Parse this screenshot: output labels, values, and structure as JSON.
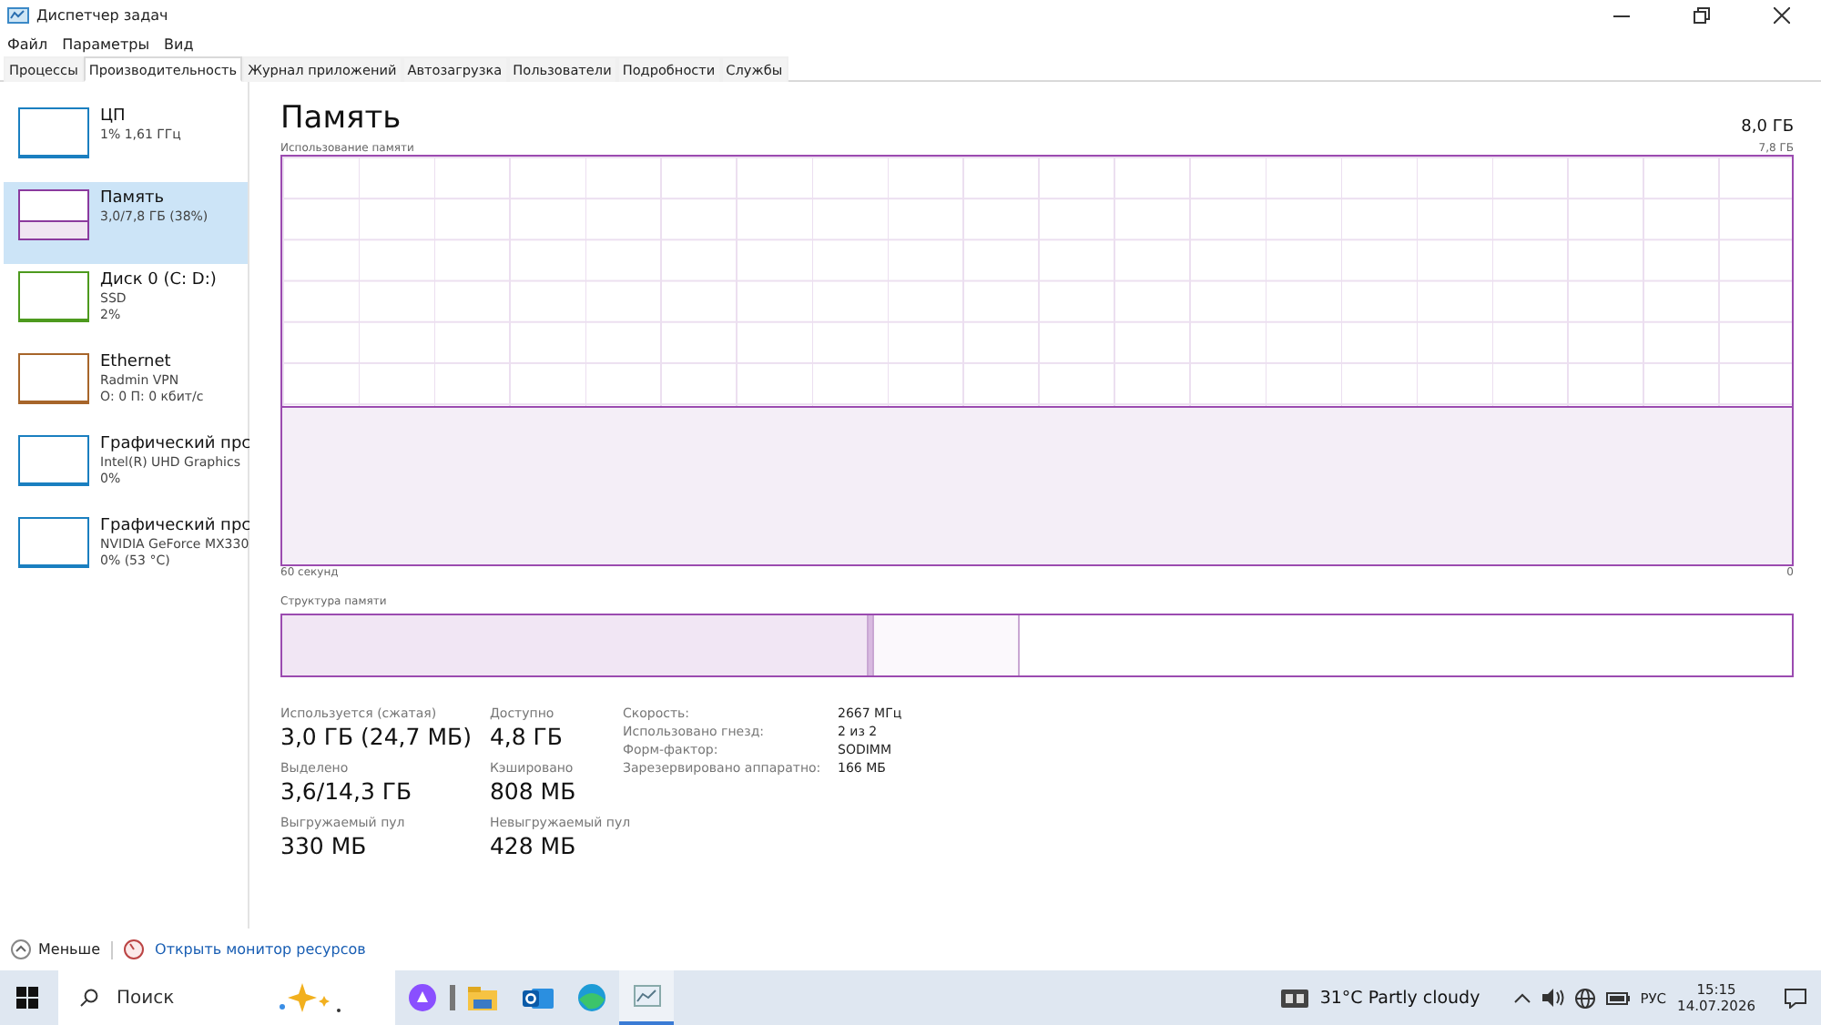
{
  "window": {
    "title": "Диспетчер задач"
  },
  "menu": [
    "Файл",
    "Параметры",
    "Вид"
  ],
  "tabs": [
    {
      "label": "Процессы",
      "selected": false
    },
    {
      "label": "Производительность",
      "selected": true
    },
    {
      "label": "Журнал приложений",
      "selected": false
    },
    {
      "label": "Автозагрузка",
      "selected": false
    },
    {
      "label": "Пользователи",
      "selected": false
    },
    {
      "label": "Подробности",
      "selected": false
    },
    {
      "label": "Службы",
      "selected": false
    }
  ],
  "sidebar": {
    "items": [
      {
        "title": "ЦП",
        "lines": [
          "1% 1,61 ГГц"
        ],
        "color": "#1a7fc0",
        "selected": false
      },
      {
        "title": "Память",
        "lines": [
          "3,0/7,8 ГБ (38%)"
        ],
        "color": "#8b3a9e",
        "selected": true
      },
      {
        "title": "Диск 0 (C: D:)",
        "lines": [
          "SSD",
          "2%"
        ],
        "color": "#4d9a1e",
        "selected": false
      },
      {
        "title": "Ethernet",
        "lines": [
          "Radmin VPN",
          "О: 0 П: 0 кбит/с"
        ],
        "color": "#a7652a",
        "selected": false
      },
      {
        "title": "Графический прс",
        "lines": [
          "Intel(R) UHD Graphics",
          "0%"
        ],
        "color": "#1a7fc0",
        "selected": false
      },
      {
        "title": "Графический прс",
        "lines": [
          "NVIDIA GeForce MX330",
          "0% (53 °C)"
        ],
        "color": "#1a7fc0",
        "selected": false
      }
    ]
  },
  "main": {
    "title": "Память",
    "total": "8,0 ГБ",
    "usage_chart": {
      "label": "Использование памяти",
      "max": "7,8 ГБ",
      "time": "60 секунд",
      "min": "0"
    },
    "structure": {
      "label": "Структура памяти",
      "segments": [
        {
          "kind": "used"
        },
        {
          "kind": "modified"
        },
        {
          "kind": "standby"
        },
        {
          "kind": "free"
        }
      ]
    },
    "stats": [
      {
        "label": "Используется (сжатая)",
        "value": "3,0 ГБ (24,7 МБ)"
      },
      {
        "label": "Доступно",
        "value": "4,8 ГБ"
      },
      {
        "label": "Выделено",
        "value": "3,6/14,3 ГБ"
      },
      {
        "label": "Кэшировано",
        "value": "808 МБ"
      },
      {
        "label": "Выгружаемый пул",
        "value": "330 МБ"
      },
      {
        "label": "Невыгружаемый пул",
        "value": "428 МБ"
      }
    ],
    "details": [
      {
        "label": "Скорость:",
        "value": "2667 МГц"
      },
      {
        "label": "Использовано гнезд:",
        "value": "2 из 2"
      },
      {
        "label": "Форм-фактор:",
        "value": "SODIMM"
      },
      {
        "label": "Зарезервировано аппаратно:",
        "value": "166 МБ"
      }
    ]
  },
  "footer": {
    "less": "Меньше",
    "monitor": "Открыть монитор ресурсов"
  },
  "taskbar": {
    "search": {
      "placeholder": "Поиск"
    },
    "weather": "31°C  Partly cloudy",
    "language": "РУС",
    "time": "15:15",
    "date": "14.07.2026"
  }
}
